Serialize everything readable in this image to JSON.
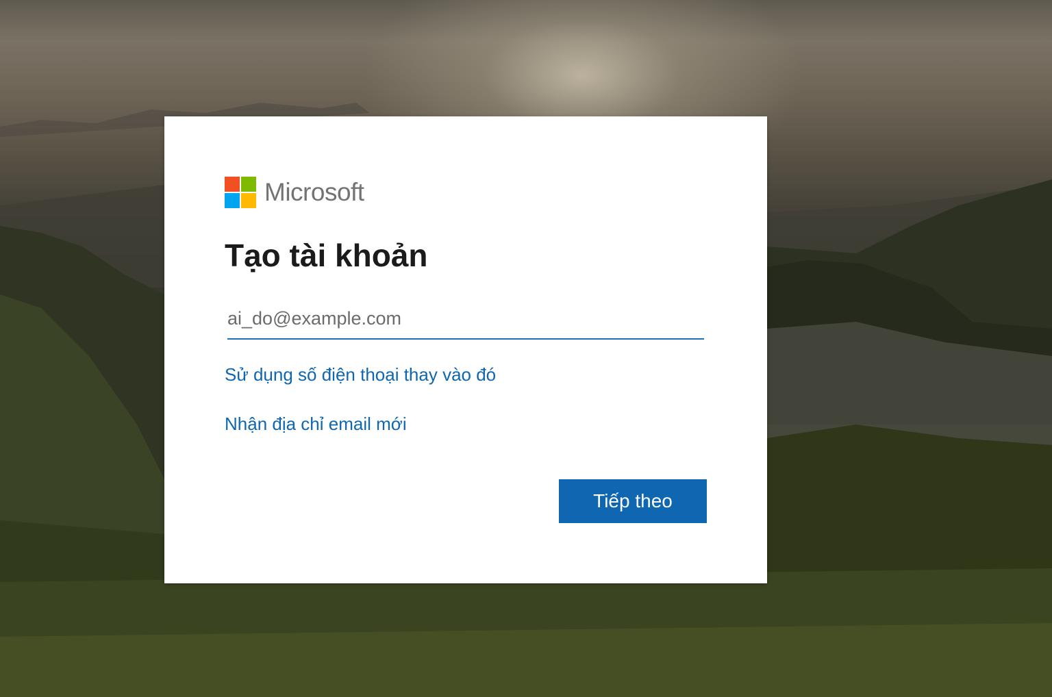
{
  "brand": {
    "name": "Microsoft",
    "logo_colors": [
      "#f25022",
      "#7fba00",
      "#00a4ef",
      "#ffb900"
    ]
  },
  "dialog": {
    "title": "Tạo tài khoản",
    "email_placeholder": "ai_do@example.com",
    "email_value": "",
    "use_phone_link": "Sử dụng số điện thoại thay vào đó",
    "new_email_link": "Nhận địa chỉ email mới",
    "next_button": "Tiếp theo"
  },
  "colors": {
    "accent": "#0f67b1",
    "button_bg": "#0f67b1",
    "input_underline": "#1a6fb5"
  }
}
